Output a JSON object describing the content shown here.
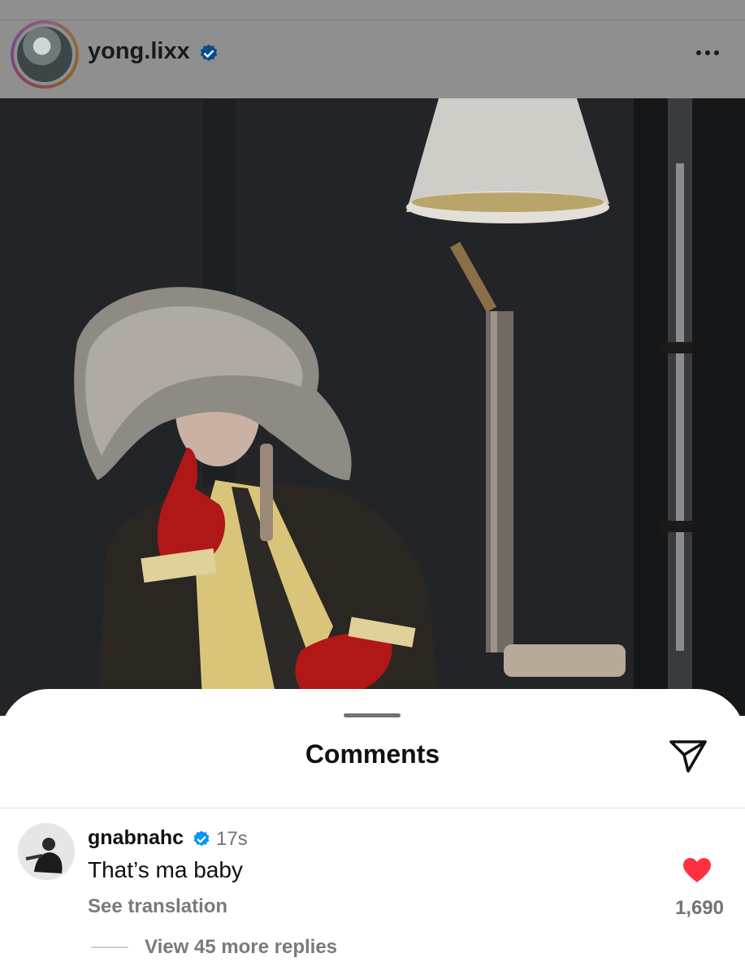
{
  "post": {
    "username": "yong.lixx",
    "verified": true,
    "more_icon": "more-horizontal-icon",
    "photo_icon": "post-photo"
  },
  "comments_sheet": {
    "title": "Comments",
    "share_icon": "send-icon",
    "comment": {
      "username": "gnabnahc",
      "verified": true,
      "time": "17s",
      "text": "That’s ma baby",
      "translation_link": "See translation",
      "like_icon": "heart-filled-icon",
      "like_count": "1,690",
      "replies_label": "View 45 more replies"
    }
  },
  "colors": {
    "verified_blue": "#0095f6",
    "like_red": "#ff3040",
    "dim_overlay": "#8f8f8f"
  }
}
